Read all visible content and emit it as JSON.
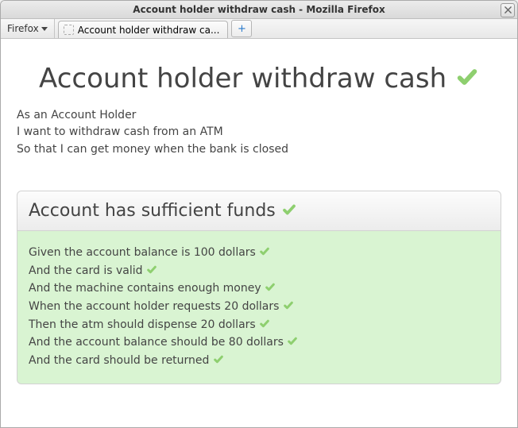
{
  "window": {
    "title": "Account holder withdraw cash - Mozilla Firefox"
  },
  "app_menu": {
    "label": "Firefox"
  },
  "tabs": {
    "active_label": "Account holder withdraw ca...",
    "new_tab_glyph": "+"
  },
  "page": {
    "heading": "Account holder withdraw cash",
    "narrative": {
      "line1": "As an Account Holder",
      "line2": "I want to withdraw cash from an ATM",
      "line3": "So that I can get money when the bank is closed"
    },
    "scenario": {
      "title": "Account has sufficient funds",
      "steps": {
        "s0": "Given the account balance is 100 dollars",
        "s1": "And the card is valid",
        "s2": "And the machine contains enough money",
        "s3": "When the account holder requests 20 dollars",
        "s4": "Then the atm should dispense 20 dollars",
        "s5": "And the account balance should be 80 dollars",
        "s6": "And the card should be returned"
      }
    }
  },
  "colors": {
    "pass_check": "#8ecf6f"
  }
}
